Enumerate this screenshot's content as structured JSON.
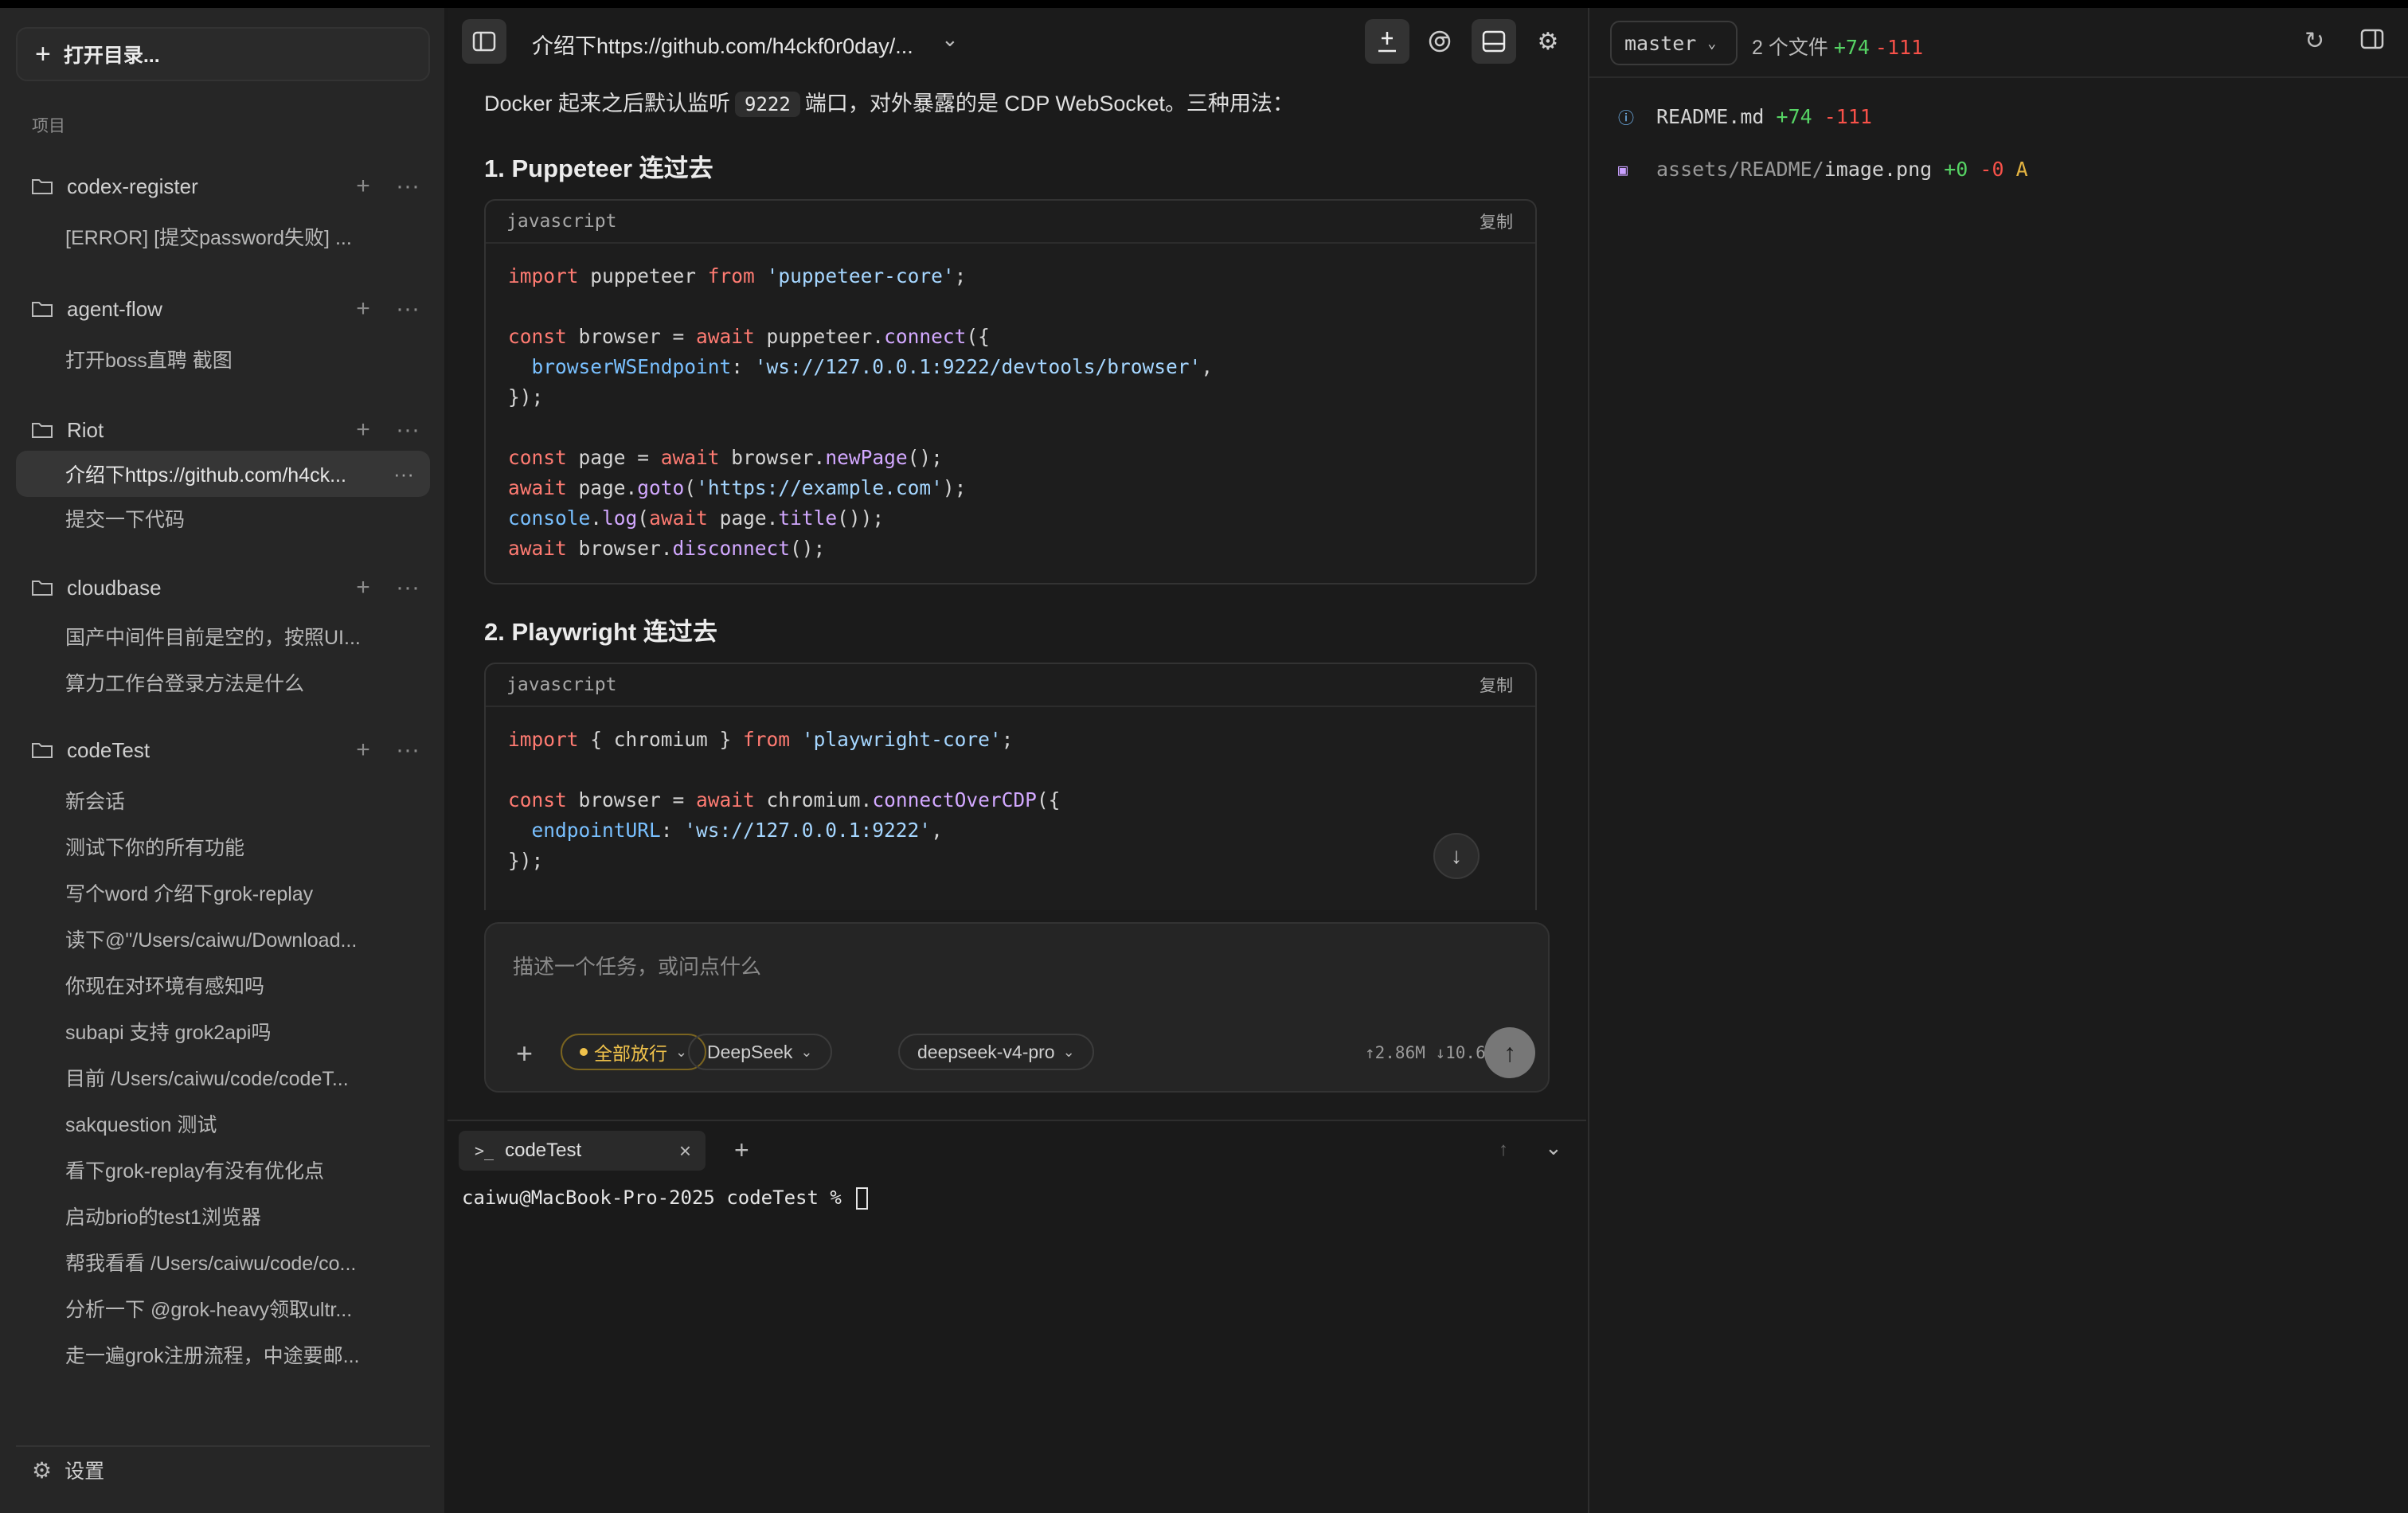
{
  "sidebar": {
    "open_dir_label": "打开目录...",
    "projects_label": "项目",
    "projects": [
      {
        "name": "codex-register",
        "items": [
          "[ERROR] [提交password失败] ..."
        ]
      },
      {
        "name": "agent-flow",
        "items": [
          "打开boss直聘 截图"
        ]
      },
      {
        "name": "Riot",
        "items": [
          "介绍下https://github.com/h4ck...",
          "提交一下代码"
        ]
      },
      {
        "name": "cloudbase",
        "items": [
          "国产中间件目前是空的，按照UI...",
          "算力工作台登录方法是什么"
        ]
      },
      {
        "name": "codeTest",
        "items": [
          "新会话",
          "测试下你的所有功能",
          "写个word 介绍下grok-replay",
          "读下@\"/Users/caiwu/Download...",
          "你现在对环境有感知吗",
          "subapi 支持 grok2api吗",
          "目前 /Users/caiwu/code/codeT...",
          "sakquestion 测试",
          "看下grok-replay有没有优化点",
          "启动brio的test1浏览器",
          "帮我看看 /Users/caiwu/code/co...",
          "分析一下 @grok-heavy领取ultr...",
          "走一遍grok注册流程，中途要邮..."
        ]
      }
    ],
    "settings_label": "设置"
  },
  "main": {
    "title": "介绍下https://github.com/h4ckf0r0day/...",
    "intro_before": "Docker 起来之后默认监听",
    "intro_code": "9222",
    "intro_after": "端口，对外暴露的是 CDP WebSocket。三种用法：",
    "section1_title": "1. Puppeteer 连过去",
    "section2_title": "2. Playwright 连过去",
    "code_lang": "javascript",
    "copy_label": "复制"
  },
  "composer": {
    "placeholder": "描述一个任务，或问点什么",
    "permission": "全部放行",
    "provider": "DeepSeek",
    "model": "deepseek-v4-pro",
    "tokens": "↑2.86M ↓10.6k"
  },
  "terminal": {
    "tab_label": "codeTest",
    "prompt": "caiwu@MacBook-Pro-2025 codeTest % "
  },
  "git": {
    "branch": "master",
    "file_count": "2 个文件",
    "additions": "+74",
    "deletions": "-111",
    "files": [
      {
        "dir": "",
        "name": "README.md",
        "add": "+74",
        "del": "-111",
        "status": ""
      },
      {
        "dir": "assets/README/",
        "name": "image.png",
        "add": "+0",
        "del": "-0",
        "status": "A"
      }
    ]
  },
  "colors": {
    "add": "#56d364",
    "del": "#f85149",
    "accent": "#f0c24b"
  }
}
